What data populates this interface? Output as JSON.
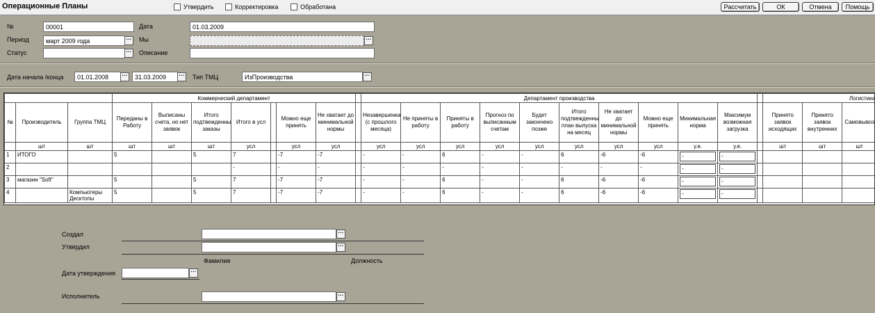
{
  "header": {
    "title": "Операционные Планы",
    "checkboxes": [
      "Утвердить",
      "Корректировка",
      "Обработана"
    ],
    "buttons": [
      "Рассчитать",
      "ОК",
      "Отмена",
      "Помощь"
    ]
  },
  "form": {
    "number_label": "№",
    "number_value": "00001",
    "date_label": "Дата",
    "date_value": "01.03.2009",
    "period_label": "Период",
    "period_value": "март 2009 года",
    "we_label": "Мы",
    "we_value": "",
    "status_label": "Статус",
    "status_value": "",
    "description_label": "Описание",
    "description_value": "",
    "date_range_label": "Дата начала /конца",
    "date_start": "01.01.2008",
    "date_end": "31.03.2009",
    "tmc_type_label": "Тип ТМЦ",
    "tmc_type_value": "ИзПроизводства"
  },
  "table": {
    "groups": [
      "Коммерческий департамент",
      "Департамент производства",
      "Логистика"
    ],
    "columns": [
      {
        "label": "№",
        "unit": ""
      },
      {
        "label": "Производитель",
        "unit": "шт"
      },
      {
        "label": "Группа ТМЦ",
        "unit": "шт"
      },
      {
        "label": "Переданы в Работу",
        "unit": "шт"
      },
      {
        "label": "Выписаны счета, но нет заявок",
        "unit": "шт"
      },
      {
        "label": "Итого подтвежденные заказы",
        "unit": "шт"
      },
      {
        "label": "Итого в усл",
        "unit": "усл"
      },
      {
        "label": "",
        "unit": ""
      },
      {
        "label": "Можно еще принять",
        "unit": "усл"
      },
      {
        "label": "Не хватает до минимальной нормы",
        "unit": "усл"
      },
      {
        "label": "",
        "unit": ""
      },
      {
        "label": "Незавершенка (с прошлого месяца)",
        "unit": "усл"
      },
      {
        "label": "Не приняты в работу",
        "unit": "усл"
      },
      {
        "label": "Приняты в работу",
        "unit": "усл"
      },
      {
        "label": "Прогноз по выписанным счетам",
        "unit": "усл"
      },
      {
        "label": "Будет закончено позже",
        "unit": "усл"
      },
      {
        "label": "Итого подтвежденный план выпуска на месяц",
        "unit": "усл"
      },
      {
        "label": "Не хватает до минимальной нормы",
        "unit": "усл"
      },
      {
        "label": "Можно еще принять",
        "unit": "усл"
      },
      {
        "label": "Минимальная норма",
        "unit": "у.е."
      },
      {
        "label": "Максимум возможная загрузка",
        "unit": "у.е."
      },
      {
        "label": "",
        "unit": ""
      },
      {
        "label": "Принято заявок исходящих",
        "unit": "шт"
      },
      {
        "label": "Принято заявок внутренних",
        "unit": "шт"
      },
      {
        "label": "Самовывоз",
        "unit": "шт"
      }
    ],
    "rows": [
      [
        "1",
        "ИТОГО",
        "",
        "5",
        "",
        "5",
        "7",
        "",
        "-7",
        "-7",
        "",
        "-",
        "-",
        "6",
        "-",
        "-",
        "6",
        "-6",
        "-6",
        "-",
        "-",
        "",
        "",
        "",
        ""
      ],
      [
        "2",
        "",
        "",
        "",
        "",
        "",
        "-",
        "",
        "-",
        "-",
        "",
        "-",
        "-",
        "-",
        "-",
        "-",
        "-",
        "-",
        "-",
        "-",
        "-",
        "",
        "",
        "",
        ""
      ],
      [
        "3",
        "магазин \"Soft\"",
        "",
        "5",
        "",
        "5",
        "7",
        "",
        "-7",
        "-7",
        "",
        "-",
        "-",
        "6",
        "-",
        "-",
        "6",
        "-6",
        "-6",
        "-",
        "-",
        "",
        "",
        "",
        ""
      ],
      [
        "4",
        "",
        "Компьютеры Десктопы",
        "5",
        "",
        "5",
        "7",
        "",
        "-7",
        "-7",
        "",
        "-",
        "-",
        "6",
        "-",
        "-",
        "6",
        "-6",
        "-6",
        "-",
        "-",
        "",
        "",
        "",
        ""
      ]
    ]
  },
  "footer": {
    "created_label": "Создал",
    "created_value": "",
    "approved_label": "Утвердил",
    "approved_value": "",
    "surname_label": "Фамилия",
    "position_label": "Должность",
    "approval_date_label": "Дата утверждения",
    "approval_date_value": "",
    "executor_label": "Исполнитель",
    "executor_value": ""
  }
}
